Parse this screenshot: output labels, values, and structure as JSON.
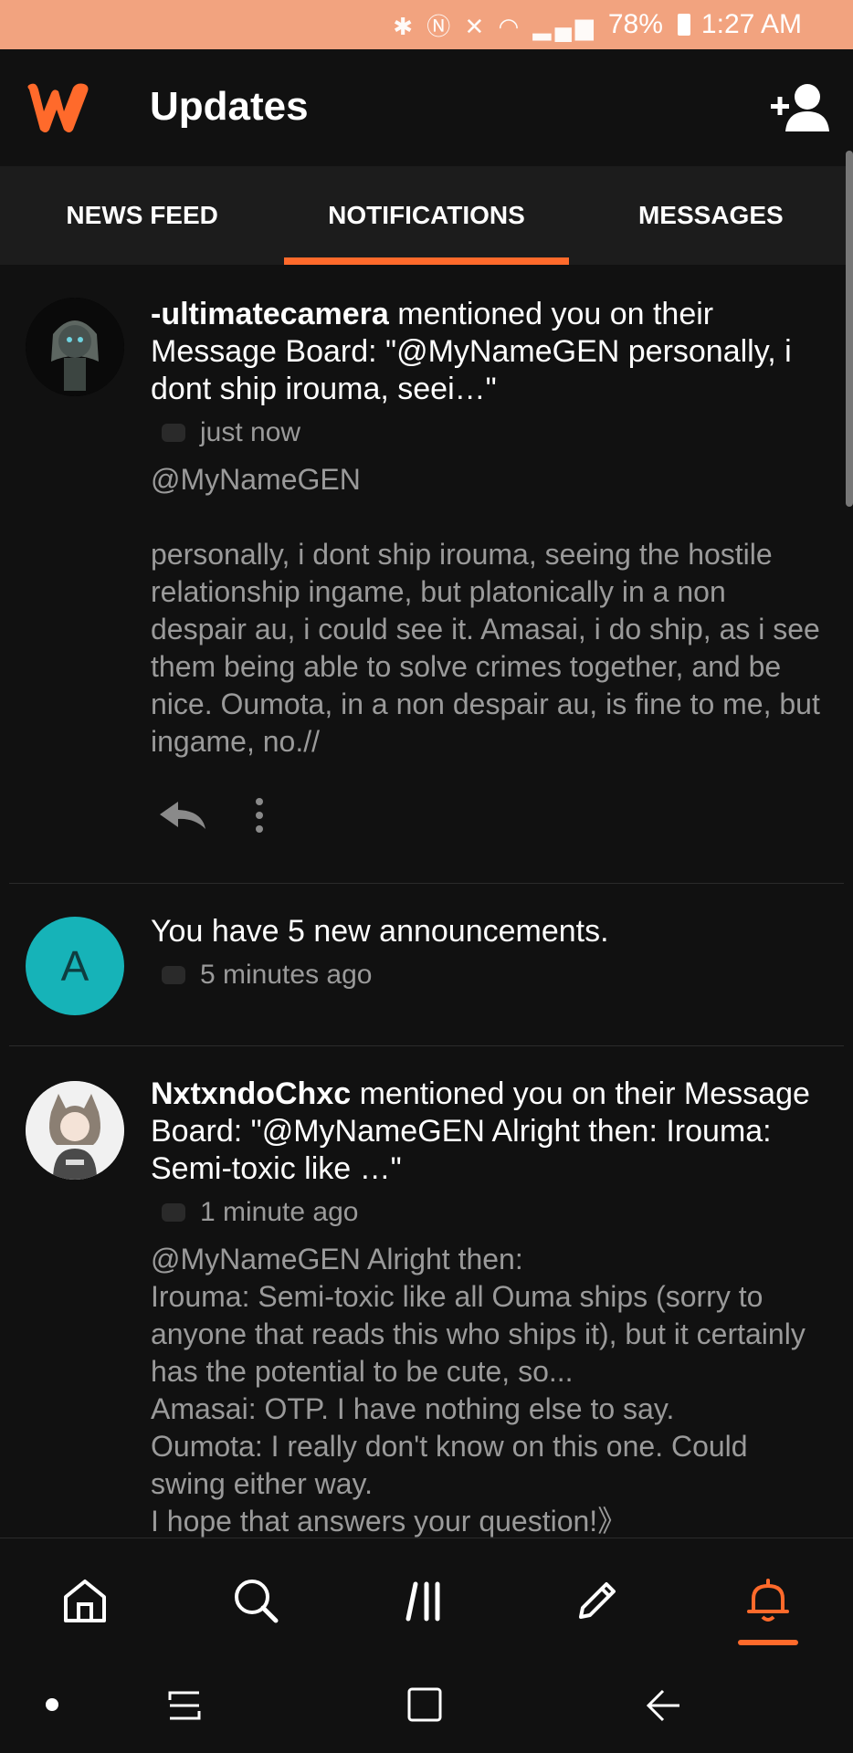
{
  "status_bar": {
    "icons": [
      "bluetooth-icon",
      "nfc-icon",
      "mute-icon",
      "wifi-icon",
      "signal-icon"
    ],
    "battery": "78%",
    "time": "1:27 AM",
    "bar_color": "#f2a37f"
  },
  "app_bar": {
    "title": "Updates",
    "logo_color": "#ff6a2b"
  },
  "tabs": [
    {
      "label": "NEWS FEED",
      "active": false
    },
    {
      "label": "NOTIFICATIONS",
      "active": true
    },
    {
      "label": "MESSAGES",
      "active": false
    }
  ],
  "notifications": [
    {
      "user": "-ultimatecamera",
      "text": " mentioned you on their Message Board: \"@MyNameGEN personally, i dont ship irouma, seei…\"",
      "time": "just now",
      "body_lines": [
        "@MyNameGEN",
        "",
        "personally, i dont ship irouma, seeing the hostile relationship ingame, but platonically in a non despair au, i could see it. Amasai, i do ship, as i see them being able to solve crimes together, and be nice. Oumota, in a non despair au, is fine to me, but ingame, no.//"
      ]
    },
    {
      "avatar_letter": "A",
      "text": "You have 5 new announcements.",
      "time": "5 minutes ago"
    },
    {
      "user": "NxtxndoChxc",
      "text": " mentioned you on their Message Board: \"@MyNameGEN Alright then: Irouma: Semi-toxic like …\"",
      "time": "1 minute ago",
      "body_lines": [
        "@MyNameGEN Alright then:",
        "Irouma: Semi-toxic like all Ouma ships (sorry to anyone that reads this who ships it), but it certainly has the potential to be cute, so...",
        "Amasai: OTP. I have nothing else to say.",
        "Oumota: I really don't know on this one. Could swing either way.",
        "I hope that answers your question!》"
      ]
    }
  ],
  "bottom_nav": [
    "home-icon",
    "search-icon",
    "library-icon",
    "write-icon",
    "notifications-bell-icon"
  ],
  "accent_color": "#ff6a2b"
}
